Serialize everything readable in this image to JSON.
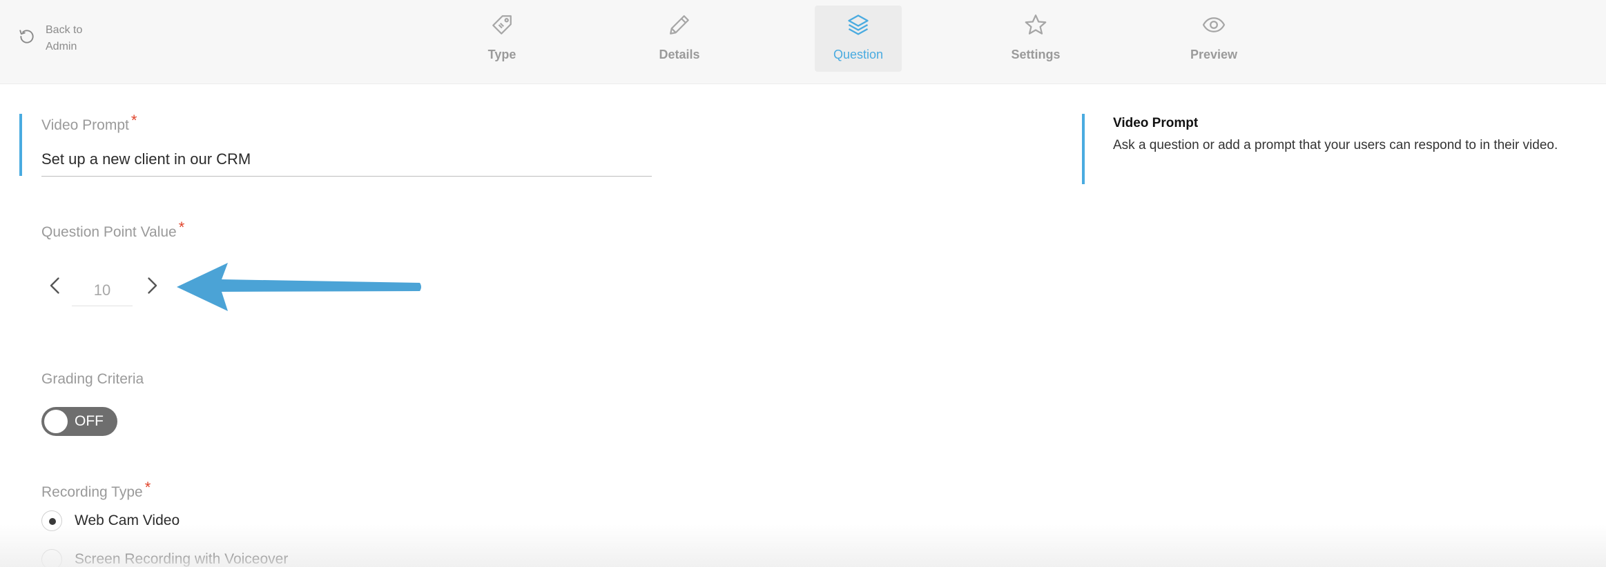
{
  "nav": {
    "back_label": "Back to Admin",
    "steps": [
      {
        "label": "Type",
        "icon": "tag-icon",
        "active": false
      },
      {
        "label": "Details",
        "icon": "pencil-icon",
        "active": false
      },
      {
        "label": "Question",
        "icon": "layers-icon",
        "active": true
      },
      {
        "label": "Settings",
        "icon": "star-icon",
        "active": false
      },
      {
        "label": "Preview",
        "icon": "eye-icon",
        "active": false
      }
    ]
  },
  "form": {
    "video_prompt": {
      "label": "Video Prompt",
      "required_mark": "*",
      "value": "Set up a new client in our CRM"
    },
    "point_value": {
      "label": "Question Point Value",
      "required_mark": "*",
      "value": "10"
    },
    "grading_criteria": {
      "label": "Grading Criteria",
      "toggle_text": "OFF"
    },
    "recording_type": {
      "label": "Recording Type",
      "required_mark": "*",
      "options": [
        {
          "label": "Web Cam Video",
          "selected": true
        },
        {
          "label": "Screen Recording with Voiceover",
          "selected": false
        }
      ]
    }
  },
  "help": {
    "title": "Video Prompt",
    "text": "Ask a question or add a prompt that your users can respond to in their video."
  },
  "colors": {
    "accent": "#4aabe0",
    "required": "#e0442b",
    "toggle_off": "#6e6e6e",
    "annotation_arrow": "#4ba3d6"
  }
}
